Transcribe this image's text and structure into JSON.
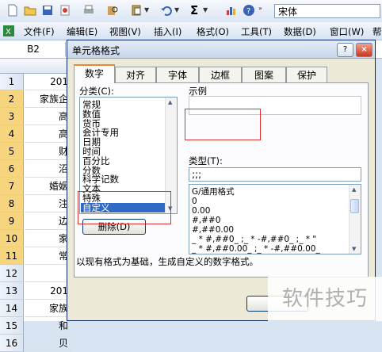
{
  "toolbar": {
    "font_name": "宋体",
    "sum_label": "Σ"
  },
  "menubar": {
    "items": [
      "文件(F)",
      "编辑(E)",
      "视图(V)",
      "插入(I)",
      "格式(O)",
      "工具(T)",
      "数据(D)",
      "窗口(W)",
      "帮"
    ]
  },
  "name_box": "B2",
  "sheet": {
    "rows": [
      {
        "num": "1",
        "cell": "201"
      },
      {
        "num": "2",
        "cell": "家族企"
      },
      {
        "num": "3",
        "cell": "高"
      },
      {
        "num": "4",
        "cell": "高"
      },
      {
        "num": "5",
        "cell": "财"
      },
      {
        "num": "6",
        "cell": "沼"
      },
      {
        "num": "7",
        "cell": "婚姻"
      },
      {
        "num": "8",
        "cell": "注"
      },
      {
        "num": "9",
        "cell": "边"
      },
      {
        "num": "10",
        "cell": "家"
      },
      {
        "num": "11",
        "cell": "常"
      },
      {
        "num": "12",
        "cell": ""
      },
      {
        "num": "13",
        "cell": "201"
      },
      {
        "num": "14",
        "cell": "家族"
      },
      {
        "num": "15",
        "cell": "和"
      },
      {
        "num": "16",
        "cell": "贝"
      }
    ]
  },
  "dialog": {
    "title": "单元格格式",
    "tabs": [
      "数字",
      "对齐",
      "字体",
      "边框",
      "图案",
      "保护"
    ],
    "category_label": "分类(C):",
    "categories": [
      "常规",
      "数值",
      "货币",
      "会计专用",
      "日期",
      "时间",
      "百分比",
      "分数",
      "科学记数",
      "文本",
      "特殊",
      "自定义"
    ],
    "selected_category": "自定义",
    "sample_label": "示例",
    "type_label": "类型(T):",
    "type_value": ";;;",
    "formats": [
      "G/通用格式",
      "0",
      "0.00",
      "#,##0",
      "#,##0.00",
      "_ * #,##0_ ;_ * -#,##0_ ;_ * \"",
      "_ * #,##0.00_ ;_ * -#,##0.00_"
    ],
    "delete_button": "删除(D)",
    "description": "以现有格式为基础，生成自定义的数字格式。",
    "help_button": "?",
    "close_button": "×"
  },
  "watermark": "软件技巧"
}
